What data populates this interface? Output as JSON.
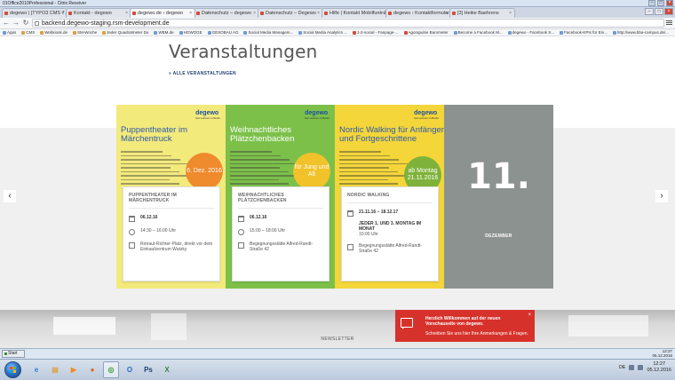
{
  "citrix": {
    "title": "01Office2010Professional - Citrix Receiver",
    "minimize": "–",
    "maximize": "□",
    "close": "×"
  },
  "browser": {
    "tabs": [
      {
        "label": "degewo | [TYPO3 CMS 7.6.9]",
        "active": false
      },
      {
        "label": "Kontakt - degewo",
        "active": false
      },
      {
        "label": "degewo.de › degewo",
        "active": true
      },
      {
        "label": "Datenschutz – degewo",
        "active": false
      },
      {
        "label": "Datenschutz – Degewo",
        "active": false
      },
      {
        "label": "Hilfe | Kontakt Mobilfunk & I…",
        "active": false
      },
      {
        "label": "degewo › Kontaktformular",
        "active": false
      },
      {
        "label": "[3] Heike Baehrens",
        "active": false
      }
    ],
    "tab_close": "×",
    "url": "backend.degewo-staging.rsm-development.de",
    "back": "←",
    "forward": "→",
    "reload": "↻",
    "bookmarks": [
      {
        "label": "Apps",
        "style": "flat"
      },
      {
        "label": "CMS",
        "style": "folder"
      },
      {
        "label": "Webkiosk.de",
        "style": "folder"
      },
      {
        "label": "SM-Woche",
        "style": "folder"
      },
      {
        "label": "Jeder Quadratmeter Du",
        "style": "folder"
      },
      {
        "label": "WBM.de",
        "style": "flat"
      },
      {
        "label": "HOWOGE",
        "style": "flat"
      },
      {
        "label": "GESOBAU AG",
        "style": "flat"
      },
      {
        "label": "Social Media Managem...",
        "style": "flat"
      },
      {
        "label": "Social Media Analytics ...",
        "style": "flat"
      },
      {
        "label": "1-2-social - Fanpage-...",
        "style": "red"
      },
      {
        "label": "Agorapulse Barometer",
        "style": "red"
      },
      {
        "label": "Become a Facebook M...",
        "style": "flat"
      },
      {
        "label": "degewo - Facebook S...",
        "style": "flat"
      },
      {
        "label": "Facebook-KPIs für Ein...",
        "style": "flat"
      },
      {
        "label": "http://www.bba-campus.de/...",
        "style": "flat"
      }
    ]
  },
  "page": {
    "title": "Veranstaltungen",
    "all_events_link": "» ALLE VERANSTALTUNGEN",
    "prev_arrow": "‹",
    "next_arrow": "›",
    "events": [
      {
        "poster_logo": "degewo",
        "poster_tagline": "Gut wohnen in Berlin",
        "poster_title": "Puppentheater im Märchentruck",
        "poster_badge": "6. Dez. 2016",
        "poster_bg": "#f3ea7c",
        "title_color": "#2f5aa8",
        "badge_color": "#ef8a2d",
        "card_title": "PUPPENTHEATER IM MÄRCHENTRUCK",
        "date": "06.12.16",
        "time": "14:30 – 16:00 Uhr",
        "location": "Rotraut-Richter-Platz, direkt vor dem Einkaufzentrum Wutzky"
      },
      {
        "poster_logo": "degewo",
        "poster_tagline": "Gut wohnen in Berlin",
        "poster_title": "Weihnachtliches Plätzchenbacken",
        "poster_badge": "für Jung und Alt",
        "poster_bg": "#7cc04a",
        "title_color": "#ffffff",
        "badge_color": "#f2c22a",
        "card_title": "WEIHNACHTLICHES PLÄTZCHENBACKEN",
        "date": "06.12.16",
        "time": "15:00 – 18:00 Uhr",
        "location": "Begegnungsstätte Alfred-Randt-Straße 42"
      },
      {
        "poster_logo": "degewo",
        "poster_tagline": "Gut wohnen in Berlin",
        "poster_title": "Nordic Walking für Anfänger und Fortgeschrittene",
        "poster_badge": "ab Montag 21.11.2016",
        "poster_bg": "#f4d63a",
        "title_color": "#2f5aa8",
        "badge_color": "#7fb23b",
        "card_title": "NORDIC WALKING",
        "date": "21.11.16 – 18.12.17",
        "schedule": "JEDER 1. UND 3. MONTAG IM MONAT",
        "time": "10:00 Uhr",
        "location": "Begegnungsstätte Alfred-Randt-Straße 42"
      }
    ],
    "date_tile": {
      "day": "11.",
      "month": "DEZEMBER"
    },
    "newsletter": "NEWSLETTER",
    "toast": {
      "title": "Herzlich Willkommen auf der neuen Vorschauseite von degewo.",
      "text": "Schreiben Sie uns hier Ihre Anmerkungen & Fragen.",
      "close": "×"
    }
  },
  "citrix_taskbar": {
    "start": "Start",
    "tray_time": "12:27",
    "tray_date": "05.12.2016"
  },
  "windows_taskbar": {
    "apps": [
      {
        "name": "ie",
        "glyph": "e",
        "color": "#2e7fd1"
      },
      {
        "name": "explorer",
        "glyph": "▤",
        "color": "#d9a23a"
      },
      {
        "name": "media",
        "glyph": "▶",
        "color": "#f08a1c"
      },
      {
        "name": "firefox",
        "glyph": "●",
        "color": "#e06a1f"
      },
      {
        "name": "chrome",
        "glyph": "◎",
        "color": "#3c9b3c"
      },
      {
        "name": "outlook",
        "glyph": "O",
        "color": "#2a6cc4"
      },
      {
        "name": "photoshop",
        "glyph": "Ps",
        "color": "#1c3e6e"
      },
      {
        "name": "excel",
        "glyph": "X",
        "color": "#2e8a3f"
      }
    ],
    "lang": "DE",
    "time": "12:27",
    "date": "05.12.2016"
  }
}
